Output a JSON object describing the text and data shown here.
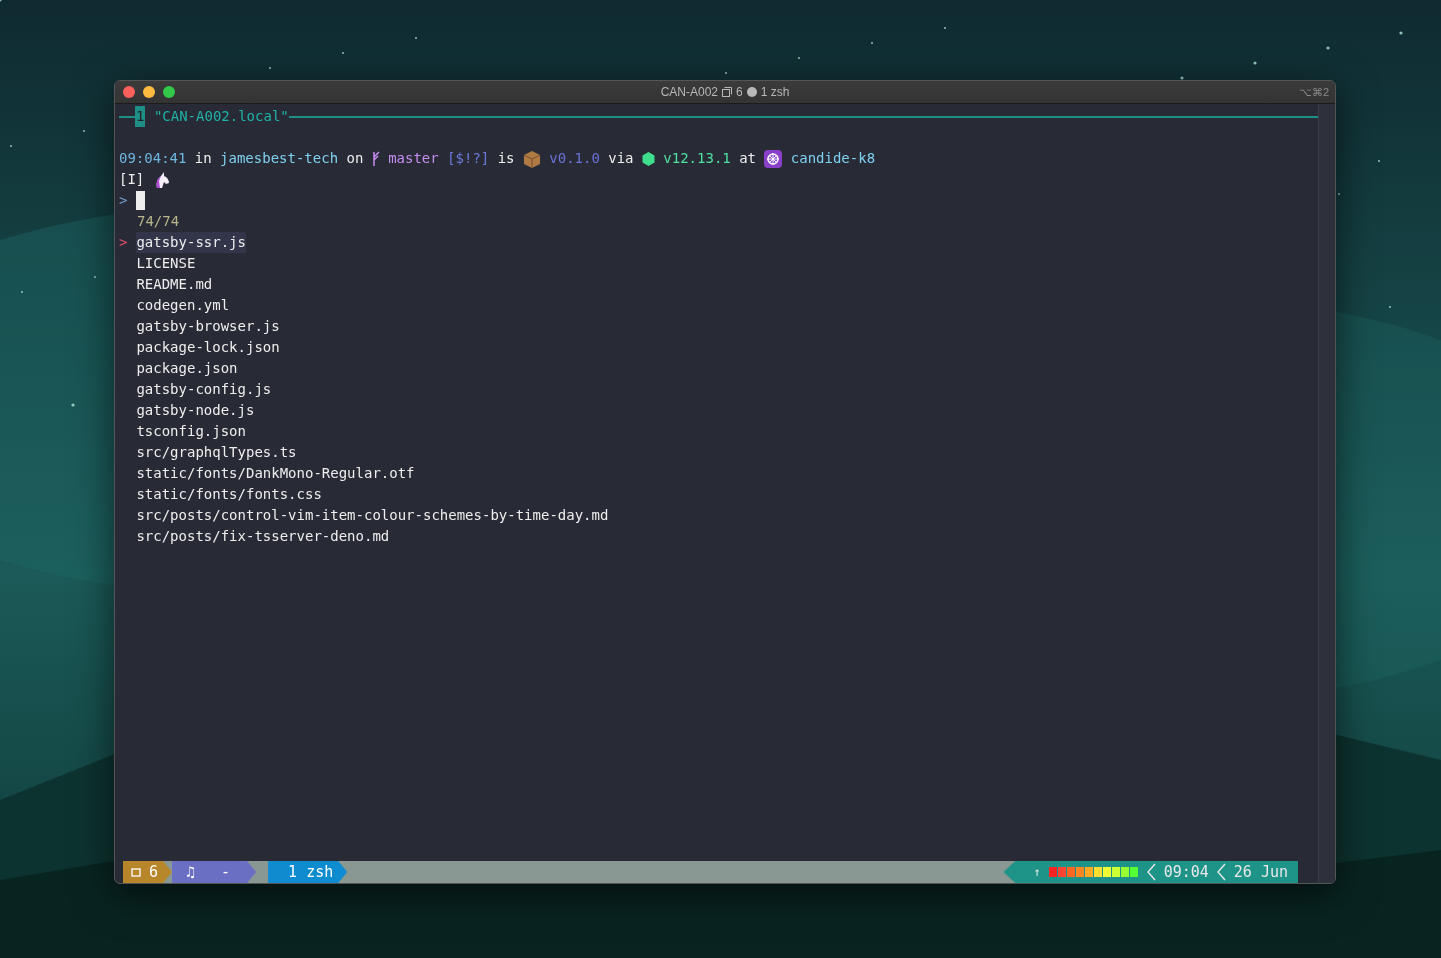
{
  "window": {
    "title": "CAN-A002",
    "window_count": "6",
    "pane": "1 zsh",
    "shortcut": "⌥⌘2"
  },
  "session": {
    "number": "1",
    "name": "\"CAN-A002.local\""
  },
  "prompt": {
    "segments": [
      {
        "kind": "time",
        "text": "09:04:41"
      },
      {
        "kind": "plain",
        "text": "in"
      },
      {
        "kind": "dir",
        "text": "jamesbest-tech"
      },
      {
        "kind": "plain",
        "text": "on"
      },
      {
        "kind": "branch",
        "text": "master"
      },
      {
        "kind": "status",
        "text": "[$!?]"
      },
      {
        "kind": "plain",
        "text": "is"
      },
      {
        "kind": "package",
        "text": "v0.1.0"
      },
      {
        "kind": "plain",
        "text": "via"
      },
      {
        "kind": "node",
        "text": "v12.13.1"
      },
      {
        "kind": "plain",
        "text": "at"
      },
      {
        "kind": "k8s",
        "text": "candide-k8"
      }
    ],
    "mode": "[I]",
    "symbol": ">"
  },
  "finder": {
    "count": "74/74",
    "pointer": ">",
    "items": [
      {
        "text": "gatsby-ssr.js",
        "selected": true
      },
      {
        "text": "LICENSE",
        "selected": false
      },
      {
        "text": "README.md",
        "selected": false
      },
      {
        "text": "codegen.yml",
        "selected": false
      },
      {
        "text": "gatsby-browser.js",
        "selected": false
      },
      {
        "text": "package-lock.json",
        "selected": false
      },
      {
        "text": "package.json",
        "selected": false
      },
      {
        "text": "gatsby-config.js",
        "selected": false
      },
      {
        "text": "gatsby-node.js",
        "selected": false
      },
      {
        "text": "tsconfig.json",
        "selected": false
      },
      {
        "text": "src/graphqlTypes.ts",
        "selected": false
      },
      {
        "text": "static/fonts/DankMono-Regular.otf",
        "selected": false
      },
      {
        "text": "static/fonts/fonts.css",
        "selected": false
      },
      {
        "text": "src/posts/control-vim-item-colour-schemes-by-time-day.md",
        "selected": false
      },
      {
        "text": "src/posts/fix-tsserver-deno.md",
        "selected": false
      }
    ]
  },
  "status_bar": {
    "window_count": "6",
    "music": "♫",
    "track": "-",
    "active_window": "1 zsh",
    "upload": "↑",
    "clock": "09:04",
    "date": "26 Jun"
  }
}
